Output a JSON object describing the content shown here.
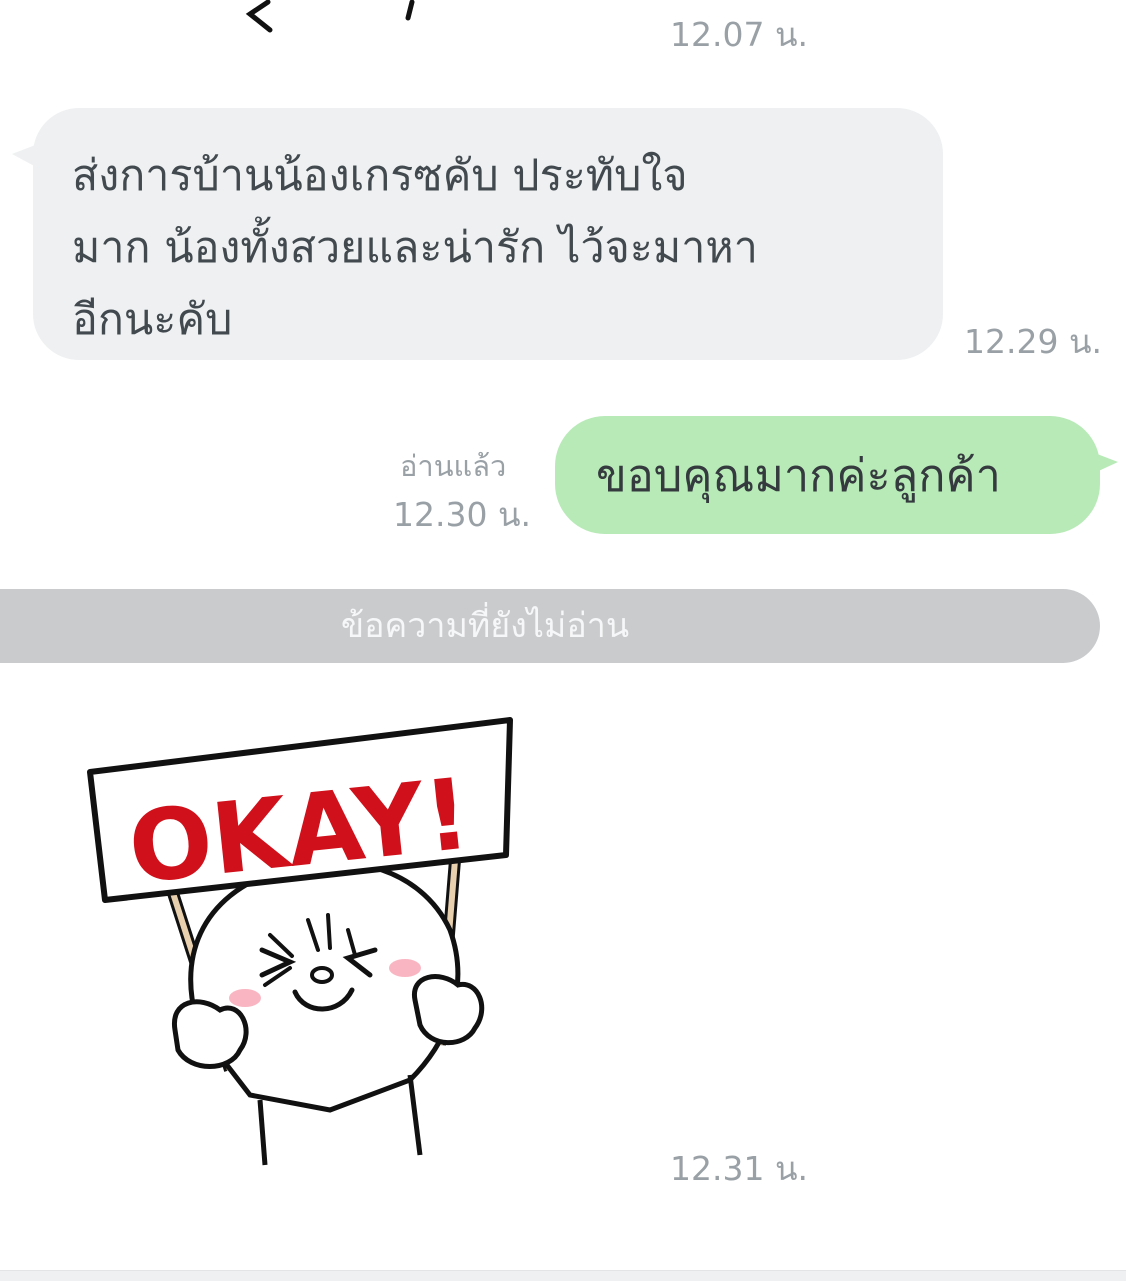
{
  "messages": [
    {
      "type": "sticker-partial",
      "time": "12.07 น."
    },
    {
      "type": "incoming",
      "text": "ส่งการบ้านน้องเกรซคับ ประทับใจ\nมาก น้องทั้งสวยและน่ารัก ไว้จะมาหา\nอีกนะคับ",
      "time": "12.29 น."
    },
    {
      "type": "outgoing",
      "text": "ขอบคุณมากค่ะลูกค้า",
      "status": "อ่านแล้ว",
      "time": "12.30 น."
    },
    {
      "type": "sticker",
      "sticker_text": "OKAY!",
      "time": "12.31 น."
    }
  ],
  "unread_divider": "ข้อความที่ยังไม่อ่าน",
  "colors": {
    "incoming_bubble": "#eef0f2",
    "outgoing_bubble": "#b8eab8",
    "divider": "#c9cbcd",
    "sticker_red": "#d0101a"
  }
}
